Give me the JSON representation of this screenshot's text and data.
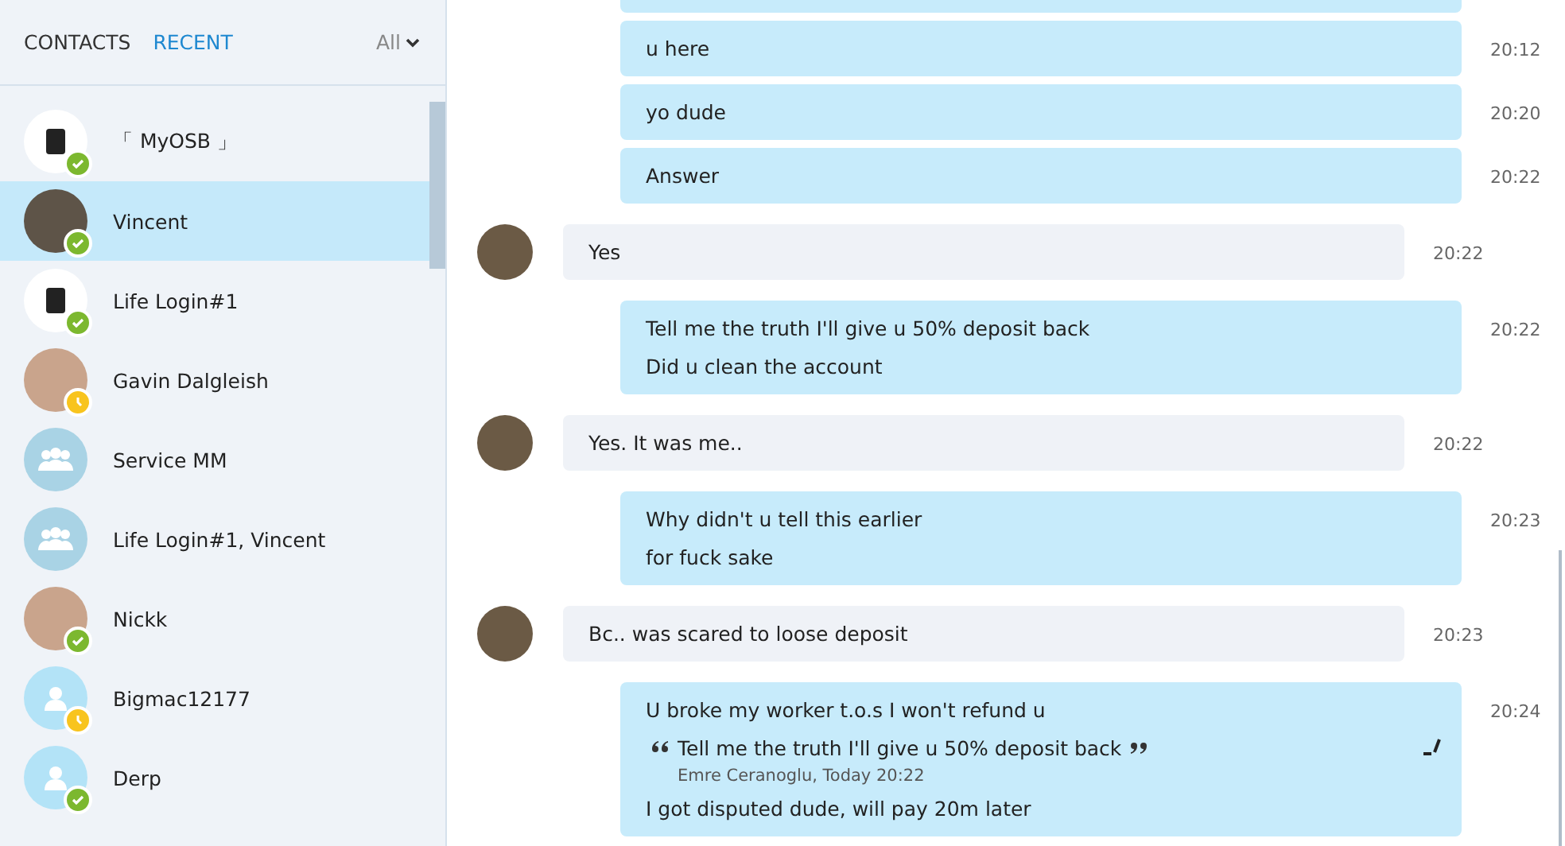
{
  "sidebar": {
    "tabs": [
      {
        "label": "CONTACTS",
        "selected": false
      },
      {
        "label": "RECENT",
        "selected": true
      }
    ],
    "filter": {
      "label": "All"
    },
    "contacts": [
      {
        "name": "「 MyOSB 」",
        "kind": "logo",
        "online": true,
        "away": false,
        "selected": false
      },
      {
        "name": "Vincent",
        "kind": "photo",
        "online": true,
        "away": false,
        "selected": true
      },
      {
        "name": "Life Login#1",
        "kind": "logo",
        "online": true,
        "away": false,
        "selected": false
      },
      {
        "name": "Gavin Dalgleish",
        "kind": "photo",
        "online": false,
        "away": true,
        "selected": false
      },
      {
        "name": "Service MM",
        "kind": "group",
        "online": false,
        "away": false,
        "selected": false
      },
      {
        "name": "Life Login#1, Vincent",
        "kind": "group",
        "online": false,
        "away": false,
        "selected": false
      },
      {
        "name": "Nickk",
        "kind": "photo",
        "online": true,
        "away": false,
        "selected": false
      },
      {
        "name": "Bigmac12177",
        "kind": "person",
        "online": false,
        "away": true,
        "selected": false
      },
      {
        "name": "Derp",
        "kind": "person",
        "online": true,
        "away": false,
        "selected": false
      }
    ]
  },
  "messages": [
    {
      "kind": "outgoing",
      "lines": [
        "u here"
      ],
      "time": "20:12"
    },
    {
      "kind": "outgoing",
      "lines": [
        "yo dude"
      ],
      "time": "20:20"
    },
    {
      "kind": "outgoing",
      "lines": [
        "Answer"
      ],
      "time": "20:22"
    },
    {
      "kind": "incoming",
      "lines": [
        "Yes"
      ],
      "time": "20:22"
    },
    {
      "kind": "outgoing",
      "lines": [
        "Tell me the truth I'll give u 50% deposit back",
        "Did u clean the account"
      ],
      "time": "20:22"
    },
    {
      "kind": "incoming",
      "lines": [
        "Yes. It was me.."
      ],
      "time": "20:22"
    },
    {
      "kind": "outgoing",
      "lines": [
        "Why didn't u tell this earlier",
        "for fuck sake"
      ],
      "time": "20:23"
    },
    {
      "kind": "incoming",
      "lines": [
        "Bc.. was scared to loose deposit"
      ],
      "time": "20:23"
    },
    {
      "kind": "outgoing",
      "lines": [
        "U broke my worker t.o.s I won't refund u",
        "I got disputed dude, will pay 20m later"
      ],
      "time": "20:24",
      "edited": true,
      "quote": {
        "text": "Tell me the truth I'll give u 50% deposit back",
        "author": "Emre Ceranoglu, Today 20:22"
      }
    }
  ]
}
